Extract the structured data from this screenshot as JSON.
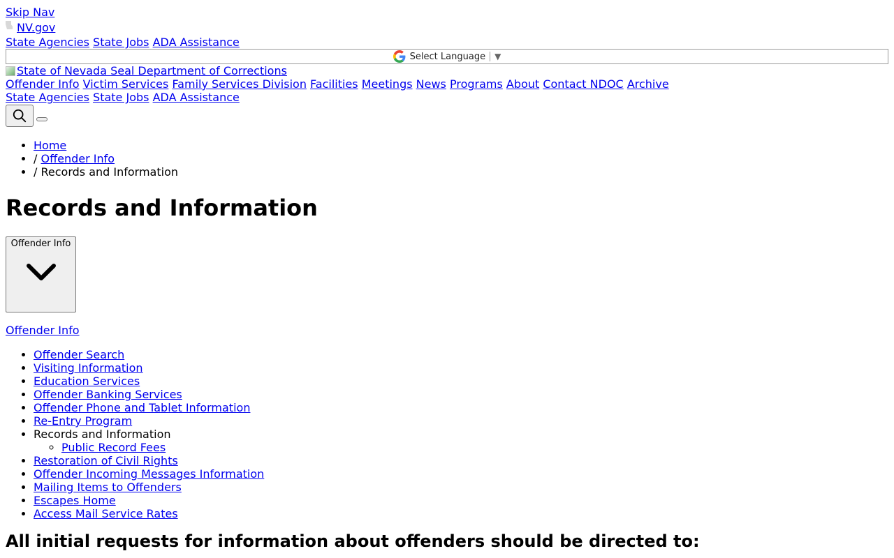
{
  "top": {
    "skip_nav": "Skip Nav",
    "nvgov": "NV.gov",
    "util_links": [
      "State Agencies",
      "State Jobs",
      "ADA Assistance"
    ]
  },
  "translate": {
    "label": "Select Language",
    "caret": "▼"
  },
  "header": {
    "logo_alt": "State of Nevada Seal Department of Corrections",
    "nav": [
      "Offender Info",
      "Victim Services",
      "Family Services Division",
      "Facilities",
      "Meetings",
      "News",
      "Programs",
      "About",
      "Contact NDOC",
      "Archive"
    ],
    "util_links": [
      "State Agencies",
      "State Jobs",
      "ADA Assistance"
    ]
  },
  "breadcrumb": {
    "home": "Home",
    "parent": "Offender Info",
    "current": "Records and Information",
    "separator": "/"
  },
  "page": {
    "title": "Records and Information",
    "dropdown_label": "Offender Info",
    "section_link": "Offender Info",
    "subheading": "All initial requests for information about offenders should be directed to:"
  },
  "sidebar": {
    "items_before": [
      "Offender Search",
      "Visiting Information",
      "Education Services",
      "Offender Banking Services",
      "Offender Phone and Tablet Information",
      "Re-Entry Program"
    ],
    "active": "Records and Information",
    "sub_items": [
      "Public Record Fees"
    ],
    "items_after": [
      "Restoration of Civil Rights",
      "Offender Incoming Messages Information",
      "Mailing Items to Offenders",
      "Escapes Home",
      "Access Mail Service Rates"
    ]
  },
  "icons": {
    "google": "google-g-icon",
    "search": "search-icon",
    "chevron": "chevron-down-icon"
  },
  "colors": {
    "link": "#0000ee",
    "text": "#000000",
    "button_bg": "#efefef"
  }
}
